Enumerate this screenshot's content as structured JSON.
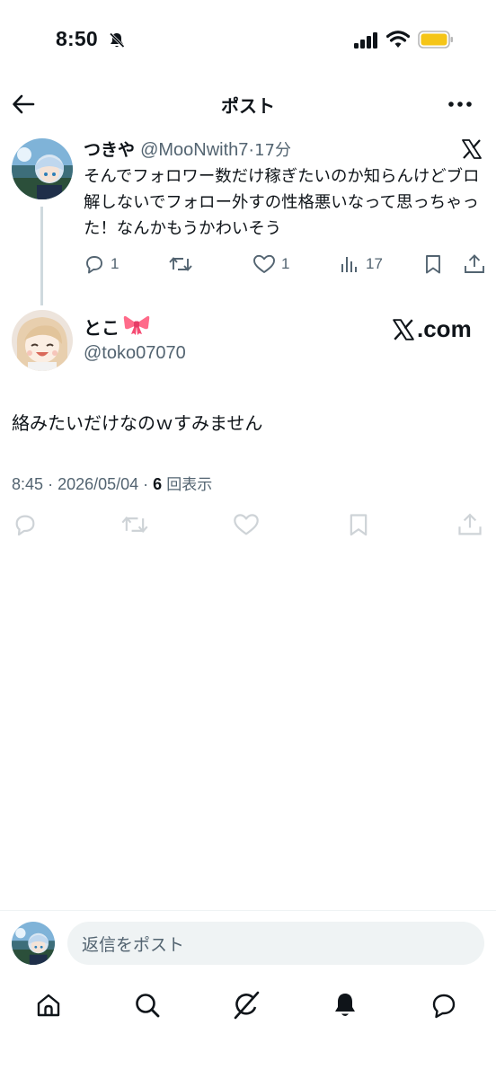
{
  "status_bar": {
    "time": "8:50"
  },
  "header": {
    "title": "ポスト"
  },
  "parent_post": {
    "author_name": "つきや",
    "handle": "@MooNwith7",
    "separator": "·",
    "time_ago": "17分",
    "text": "そんでフォロワー数だけ稼ぎたいのか知らんけどブロ解しないでフォロー外すの性格悪いなって思っちゃった！なんかもうかわいそう",
    "counts": {
      "replies": "1",
      "likes": "1",
      "views": "17"
    }
  },
  "main_post": {
    "author_name": "とこ",
    "handle": "@toko07070",
    "brand_label": ".com",
    "text": "絡みたいだけなのｗすみません",
    "time": "8:45",
    "date": "2026/05/04",
    "views_count": "6",
    "views_label": "回表示"
  },
  "reply_bar": {
    "placeholder": "返信をポスト"
  },
  "colors": {
    "text": "#0f1419",
    "secondary": "#536471",
    "divider": "#eff3f4",
    "thread_line": "#cfd9de",
    "battery": "#f5c518",
    "bow": "#ff6b8a"
  },
  "icons": {
    "status": [
      "bell-slash-icon",
      "signal-icon",
      "wifi-icon",
      "battery-icon"
    ],
    "header": [
      "back-arrow-icon",
      "more-icon"
    ],
    "actions": [
      "reply-icon",
      "repost-icon",
      "like-icon",
      "views-icon",
      "bookmark-icon",
      "share-icon"
    ],
    "nav": [
      "home-icon",
      "search-icon",
      "grok-icon",
      "notifications-icon",
      "messages-icon"
    ]
  }
}
